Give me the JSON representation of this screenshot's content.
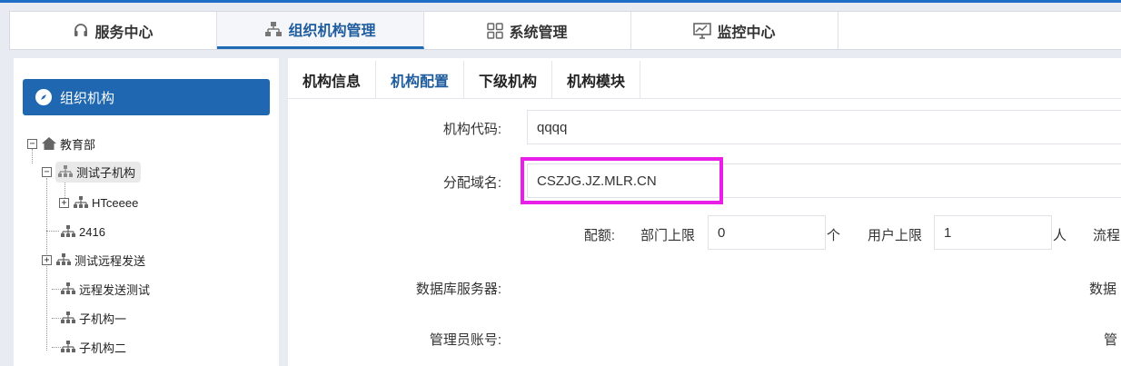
{
  "topnav": {
    "tabs": [
      {
        "label": "服务中心",
        "icon": "headset-icon"
      },
      {
        "label": "组织机构管理",
        "icon": "org-chart-icon"
      },
      {
        "label": "系统管理",
        "icon": "grid-icon"
      },
      {
        "label": "监控中心",
        "icon": "monitor-icon"
      }
    ],
    "active_index": 1
  },
  "sidebar": {
    "title": "组织机构",
    "tree": [
      {
        "label": "教育部",
        "expander": "−"
      },
      {
        "label": "测试子机构",
        "expander": "−",
        "selected": true
      },
      {
        "label": "HTceeee",
        "expander": "+"
      },
      {
        "label": "2416"
      },
      {
        "label": "测试远程发送",
        "expander": "+"
      },
      {
        "label": "远程发送测试"
      },
      {
        "label": "子机构一"
      },
      {
        "label": "子机构二"
      }
    ]
  },
  "main": {
    "subtabs": [
      "机构信息",
      "机构配置",
      "下级机构",
      "机构模块"
    ],
    "active_subtab": 1,
    "form": {
      "org_code_label": "机构代码:",
      "org_code_value": "qqqq",
      "domain_label": "分配域名:",
      "domain_value": "CSZJG.JZ.MLR.CN",
      "quota_label": "配额:",
      "dept_limit_label": "部门上限",
      "dept_limit_value": "0",
      "dept_unit": "个",
      "user_limit_label": "用户上限",
      "user_limit_value": "1",
      "user_unit": "人",
      "flow_label_partial": "流程",
      "db_server_label": "数据库服务器:",
      "db_right_partial": "数据",
      "admin_account_label": "管理员账号:",
      "admin_right_partial": "管"
    }
  },
  "colors": {
    "accent": "#1f67b0",
    "highlight": "#e91ee9"
  }
}
